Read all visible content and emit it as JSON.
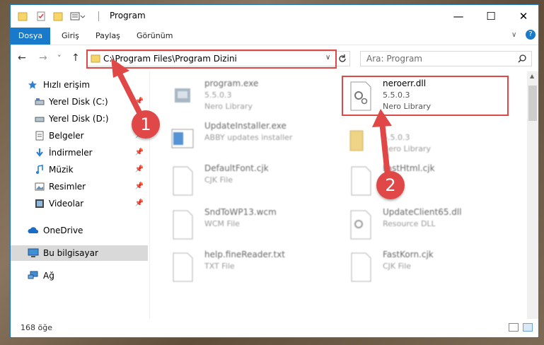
{
  "window": {
    "title": "Program",
    "controls": {
      "minimize": "—",
      "maximize": "☐",
      "close": "✕"
    }
  },
  "ribbon": {
    "tabs": [
      "Dosya",
      "Giriş",
      "Paylaş",
      "Görünüm"
    ],
    "help": "?"
  },
  "nav": {
    "back": "←",
    "forward": "→",
    "recent": "˅",
    "up": "↑",
    "address": "C:\\Program Files\\Program Dizini",
    "search_placeholder": "Ara: Program"
  },
  "sidebar": {
    "items": [
      {
        "label": "Hızlı erişim",
        "pinned": false,
        "icon": "star-icon"
      },
      {
        "label": "Yerel Disk (C:)",
        "pinned": true,
        "icon": "drive-icon"
      },
      {
        "label": "Yerel Disk (D:)",
        "pinned": true,
        "icon": "drive-icon"
      },
      {
        "label": "Belgeler",
        "pinned": true,
        "icon": "documents-icon"
      },
      {
        "label": "İndirmeler",
        "pinned": true,
        "icon": "download-icon"
      },
      {
        "label": "Müzik",
        "pinned": true,
        "icon": "music-icon"
      },
      {
        "label": "Resimler",
        "pinned": true,
        "icon": "pictures-icon"
      },
      {
        "label": "Videolar",
        "pinned": true,
        "icon": "videos-icon"
      },
      {
        "label": "OneDrive",
        "pinned": false,
        "icon": "onedrive-icon"
      },
      {
        "label": "Bu bilgisayar",
        "pinned": false,
        "icon": "computer-icon",
        "selected": true
      },
      {
        "label": "Ağ",
        "pinned": false,
        "icon": "network-icon"
      }
    ]
  },
  "files": [
    {
      "name": "program.exe",
      "line1": "5.5.0.3",
      "line2": "Nero Library",
      "type": "exe"
    },
    {
      "name": "neroerr.dll",
      "line1": "5.5.0.3",
      "line2": "Nero Library",
      "type": "dll",
      "highlighted": true
    },
    {
      "name": "UpdateInstaller.exe",
      "line1": "ABBY updates installer",
      "line2": "",
      "type": "installer"
    },
    {
      "name": "",
      "line1": "5.5.0.3",
      "line2": "Nero Library",
      "type": "folder"
    },
    {
      "name": "DefaultFont.cjk",
      "line1": "CJK File",
      "line2": "",
      "type": "blank"
    },
    {
      "name": "FastHtml.cjk",
      "line1": "",
      "line2": "",
      "type": "blank"
    },
    {
      "name": "SndToWP13.wcm",
      "line1": "WCM File",
      "line2": "",
      "type": "blank"
    },
    {
      "name": "UpdateClient65.dll",
      "line1": "Resource DLL",
      "line2": "",
      "type": "dll"
    },
    {
      "name": "help.fineReader.txt",
      "line1": "TXT File",
      "line2": "",
      "type": "blank"
    },
    {
      "name": "FastKorn.cjk",
      "line1": "CJK File",
      "line2": "",
      "type": "blank"
    }
  ],
  "status": {
    "count": "168 öğe"
  },
  "annotations": {
    "badge1": "1",
    "badge2": "2"
  },
  "colors": {
    "accent": "#1979ca",
    "highlight": "#e04848"
  }
}
